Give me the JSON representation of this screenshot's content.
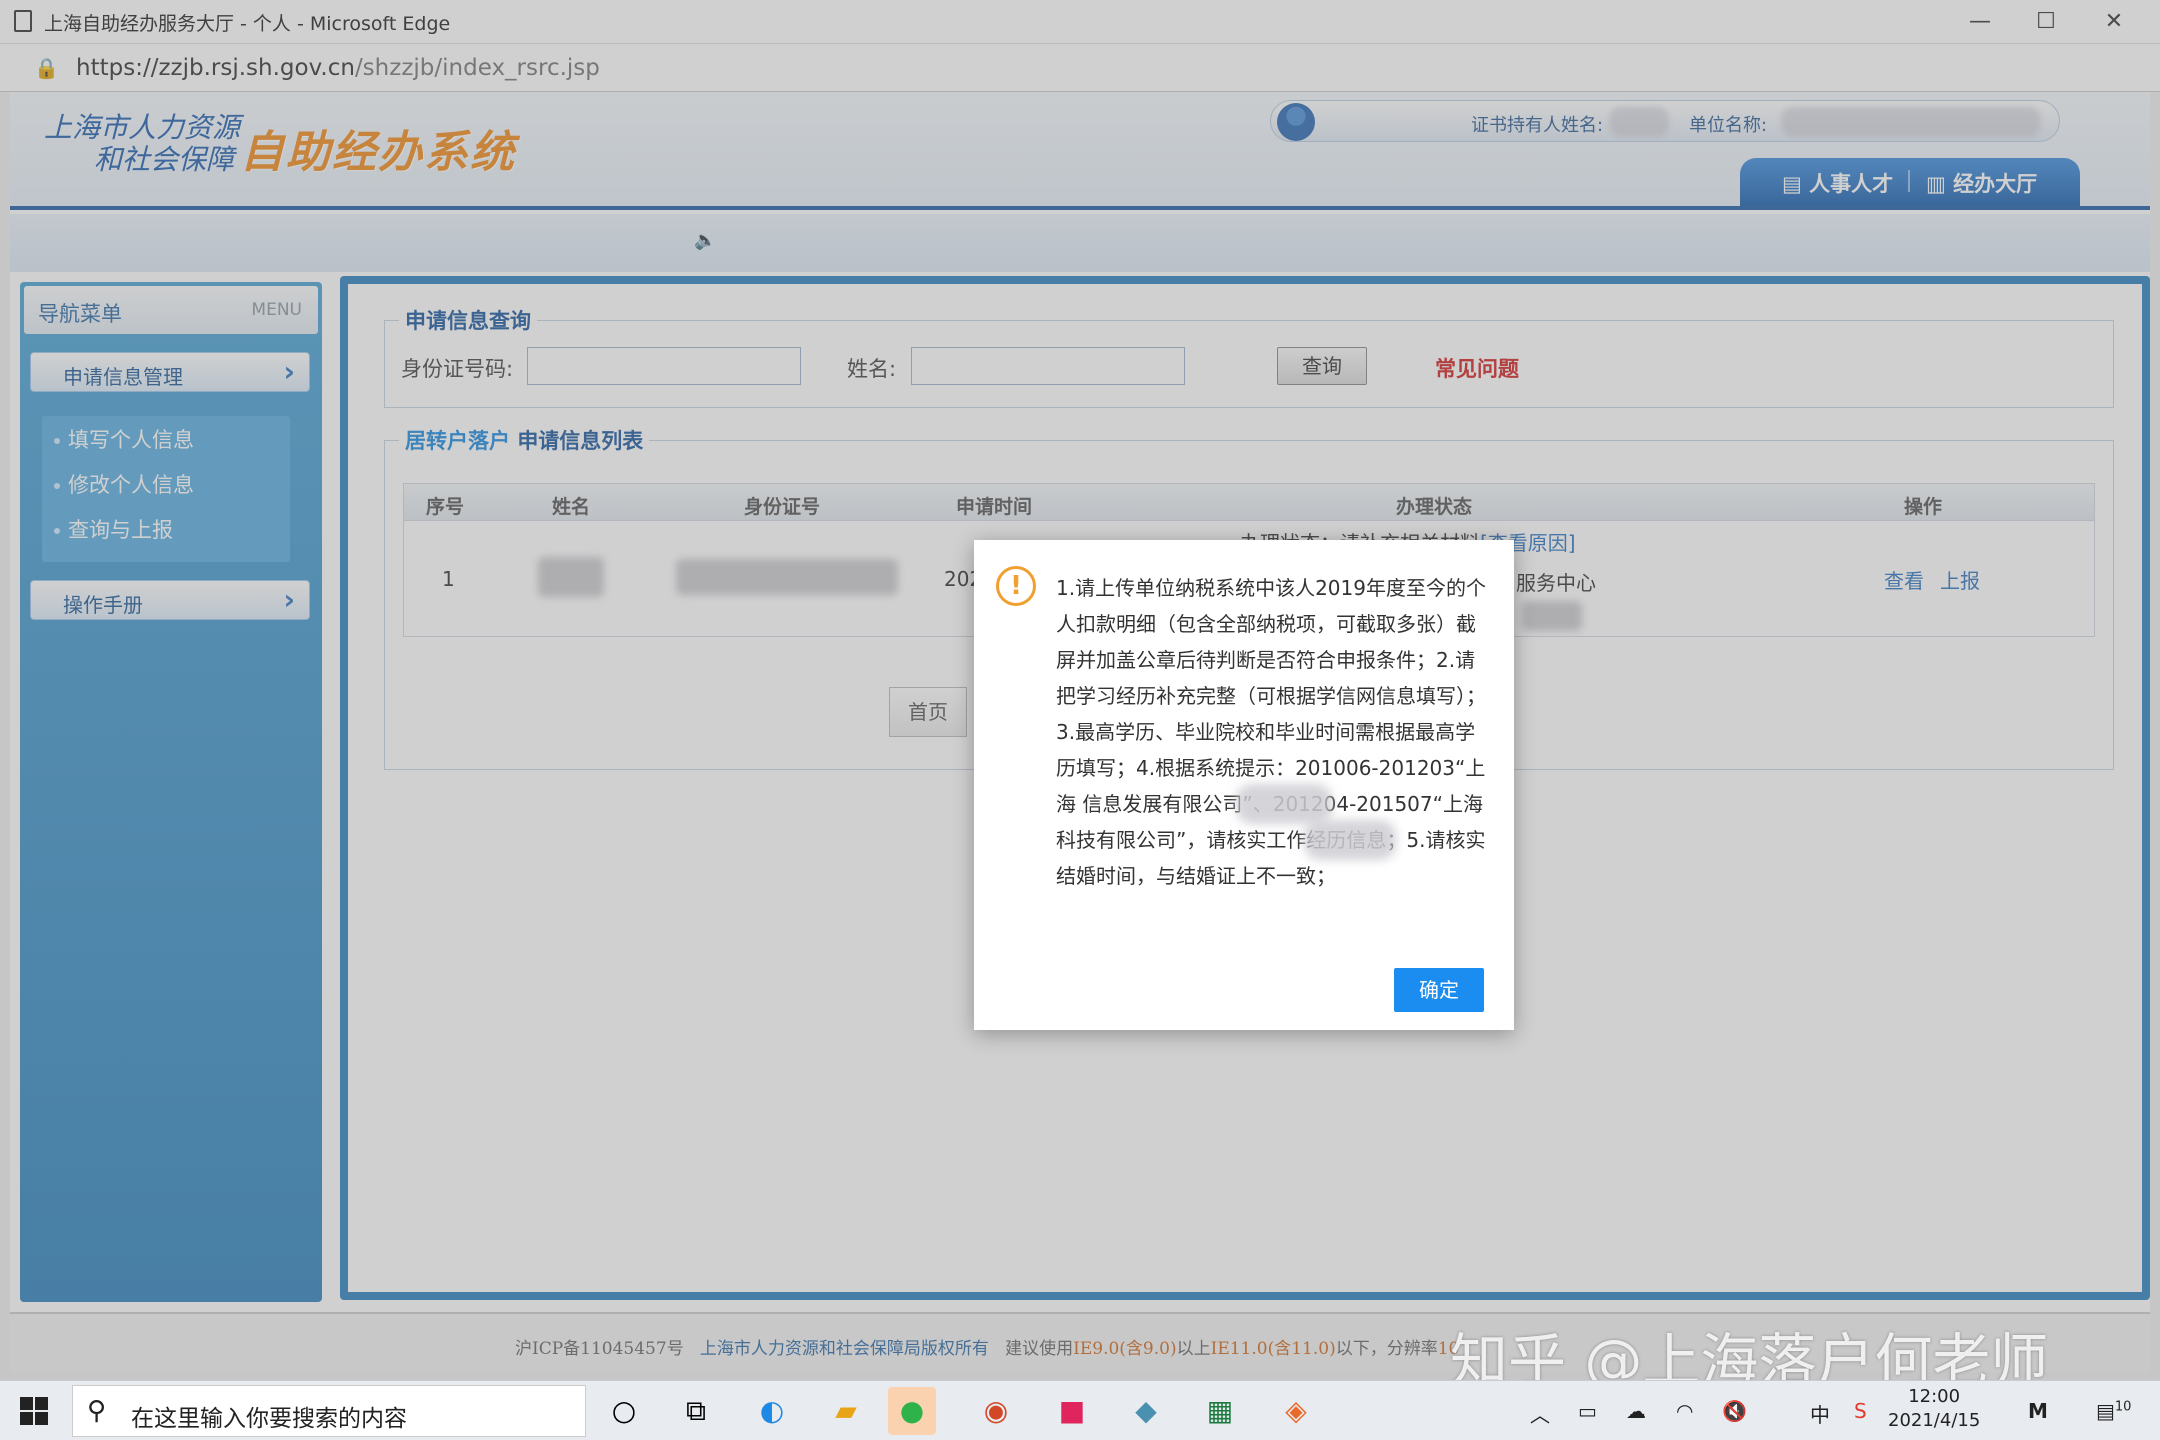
{
  "browser": {
    "title": "上海自助经办服务大厅 - 个人 - Microsoft Edge",
    "url_host": "https://zzjb.rsj.sh.gov.cn",
    "url_path": "/shzzjb/index_rsrc.jsp",
    "minimize": "—",
    "maximize": "☐",
    "close": "✕"
  },
  "header": {
    "logo_line1": "上海市人力资源",
    "logo_line2": "和社会保障",
    "system_name": "自助经办系统",
    "cert_holder_label": "证书持有人姓名:",
    "unit_label": "单位名称:",
    "tab_hr": "人事人才",
    "tab_hall": "经办大厅"
  },
  "sidebar": {
    "title": "导航菜单",
    "title_en": "MENU",
    "group1": "申请信息管理",
    "items": [
      "填写个人信息",
      "修改个人信息",
      "查询与上报"
    ],
    "group2": "操作手册"
  },
  "query": {
    "legend": "申请信息查询",
    "id_label": "身份证号码:",
    "name_label": "姓名:",
    "search_btn": "查询",
    "faq": "常见问题"
  },
  "list": {
    "legend_a": "居转户落户",
    "legend_b": "申请信息列表",
    "columns": [
      "序号",
      "姓名",
      "身份证号",
      "申请时间",
      "办理状态",
      "操作"
    ],
    "row": {
      "index": "1",
      "date_partial": "202",
      "status_line1": "办理状态：请补充相关材料",
      "status_reason": "[查看原因]",
      "status_line2": "服务中心",
      "action_view": "查看",
      "action_report": "上报"
    },
    "pager_first": "首页",
    "pager_page": "页"
  },
  "dialog": {
    "icon": "!",
    "message": "1.请上传单位纳税系统中该人2019年度至今的个人扣款明细（包含全部纳税项，可截取多张）截屏并加盖公章后待判断是否符合申报条件；2.请把学习经历补充完整（可根据学信网信息填写）；3.最高学历、毕业院校和毕业时间需根据最高学历填写；4.根据系统提示：201006-201203“上海  信息发展有限公司”、201204-201507“上海  科技有限公司”，请核实工作经历信息；5.请核实结婚时间，与结婚证上不一致；",
    "ok": "确定"
  },
  "footer": {
    "icp": "沪ICP备11045457号",
    "copyright": "上海市人力资源和社会保障局版权所有",
    "browser_hint_a": "建议使用",
    "browser_hint_b": "IE9.0(含9.0)",
    "browser_hint_c": "以上",
    "browser_hint_d": "IE11.0(含11.0)",
    "browser_hint_e": "以下，分辨率",
    "browser_hint_f": "10",
    "watermark": "知乎 @上海落户何老师"
  },
  "taskbar": {
    "search_placeholder": "在这里输入你要搜索的内容",
    "ime": "中",
    "time": "12:00",
    "date": "2021/4/15",
    "notif_count": "10"
  }
}
